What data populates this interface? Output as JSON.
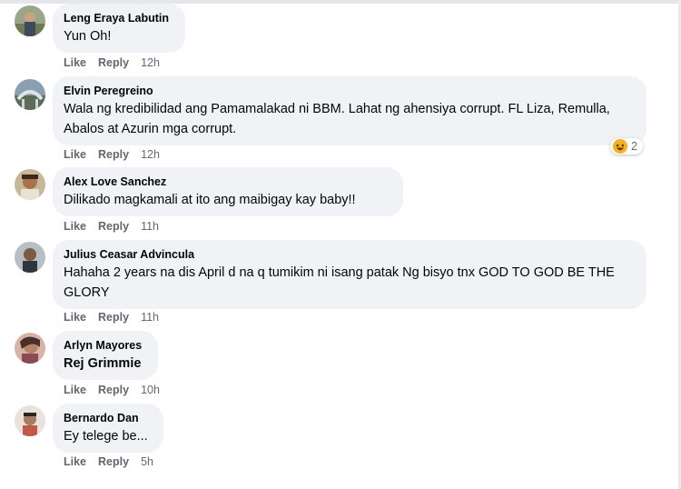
{
  "comments": [
    {
      "author": "Leng Eraya Labutin",
      "text": "Yun Oh!",
      "time": "12h"
    },
    {
      "author": "Elvin Peregreino",
      "text": "Wala ng kredibilidad ang Pamamalakad ni BBM. Lahat ng ahensiya corrupt. FL Liza, Remulla, Abalos at Azurin mga corrupt.",
      "time": "12h",
      "reaction_count": "2",
      "reaction_icon": "haha-icon"
    },
    {
      "author": "Alex Love Sanchez",
      "text": "Dilikado magkamali at ito ang maibigay kay baby!!",
      "time": "11h"
    },
    {
      "author": "Julius Ceasar Advincula",
      "text": "Hahaha 2 years na dis April d na q tumikim ni isang patak Ng bisyo tnx GOD TO GOD BE THE GLORY",
      "time": "11h"
    },
    {
      "author": "Arlyn Mayores",
      "text": "Rej Grimmie",
      "time": "10h"
    },
    {
      "author": "Bernardo Dan",
      "text": "Ey telege be...",
      "time": "5h"
    }
  ],
  "actions": {
    "like": "Like",
    "reply": "Reply"
  },
  "colors": {
    "bubble": "#f0f2f5",
    "meta": "#65676b",
    "text": "#050505",
    "reaction": "#f7b125"
  }
}
